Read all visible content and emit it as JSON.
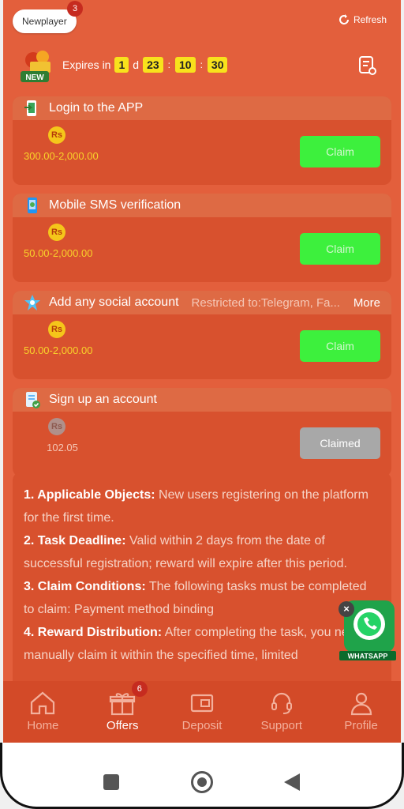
{
  "header": {
    "player_label": "Newplayer",
    "player_badge": "3",
    "refresh_label": "Refresh",
    "new_tag": "NEW",
    "expires_label": "Expires in",
    "days": "1",
    "days_unit": "d",
    "hours": "23",
    "minutes": "10",
    "seconds": "30",
    "separator": ":"
  },
  "tasks": [
    {
      "title": "Login to the APP",
      "currency": "Rs",
      "amount": "300.00-2,000.00",
      "button": "Claim",
      "icon": "phone-login-icon"
    },
    {
      "title": "Mobile SMS verification",
      "currency": "Rs",
      "amount": "50.00-2,000.00",
      "button": "Claim",
      "icon": "sms-phone-icon"
    },
    {
      "title": "Add any social account",
      "restriction": "Restricted to:Telegram, Fa...",
      "more": "More",
      "currency": "Rs",
      "amount": "50.00-2,000.00",
      "button": "Claim",
      "icon": "social-star-icon"
    },
    {
      "title": "Sign up an account",
      "currency": "Rs",
      "amount": "102.05",
      "button": "Claimed",
      "icon": "signup-doc-icon"
    }
  ],
  "rules": [
    {
      "heading": "1. Applicable Objects:",
      "text": " New users registering on the platform for the first time."
    },
    {
      "heading": "2. Task Deadline:",
      "text": " Valid within 2 days from the date of successful registration; reward will expire after this period."
    },
    {
      "heading": "3. Claim Conditions:",
      "text": " The following tasks must be completed to claim: Payment method binding"
    },
    {
      "heading": "4. Reward Distribution:",
      "text": " After completing the task, you need to manually claim it within the specified time, limited"
    }
  ],
  "whatsapp": {
    "label": "WHATSAPP",
    "close": "×"
  },
  "nav": [
    {
      "label": "Home",
      "icon": "home-icon"
    },
    {
      "label": "Offers",
      "icon": "gift-icon",
      "badge": "6"
    },
    {
      "label": "Deposit",
      "icon": "wallet-icon"
    },
    {
      "label": "Support",
      "icon": "headset-icon"
    },
    {
      "label": "Profile",
      "icon": "user-icon"
    }
  ],
  "colors": {
    "background": "#e35f3c",
    "claim_green": "#3df03d",
    "timer_yellow": "#f8e21c",
    "claimed_grey": "#a8a8a8"
  }
}
